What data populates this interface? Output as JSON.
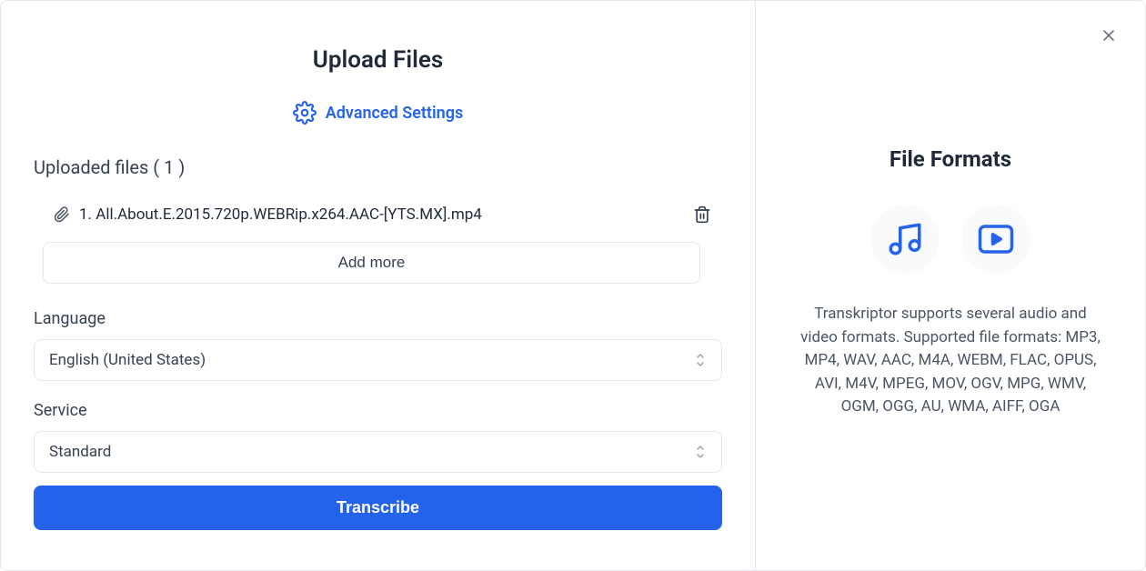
{
  "left": {
    "title": "Upload Files",
    "advanced_settings_label": "Advanced Settings",
    "uploaded_files_label": "Uploaded files ( 1 )",
    "files": [
      {
        "name": "1. All.About.E.2015.720p.WEBRip.x264.AAC-[YTS.MX].mp4"
      }
    ],
    "add_more_label": "Add more",
    "language_label": "Language",
    "language_value": "English (United States)",
    "service_label": "Service",
    "service_value": "Standard",
    "transcribe_label": "Transcribe"
  },
  "right": {
    "title": "File Formats",
    "description": "Transkriptor supports several audio and video formats. Supported file formats: MP3, MP4, WAV, AAC, M4A, WEBM, FLAC, OPUS, AVI, M4V, MPEG, MOV, OGV, MPG, WMV, OGM, OGG, AU, WMA, AIFF, OGA"
  }
}
